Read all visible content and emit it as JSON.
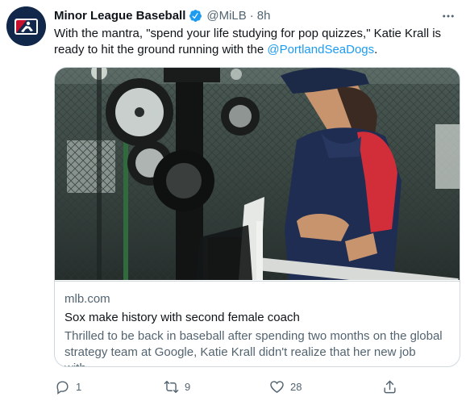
{
  "tweet": {
    "author_name": "Minor League Baseball",
    "handle": "@MiLB",
    "separator": "·",
    "time": "8h",
    "text_before": "With the mantra, \"spend your life studying for pop quizzes,\" Katie Krall is ready to hit the ground running with the ",
    "mention": "@PortlandSeaDogs",
    "text_after": "."
  },
  "card": {
    "domain": "mlb.com",
    "title": "Sox make history with second female coach",
    "description": "Thrilled to be back in baseball after spending two months on the global strategy team at Google, Katie Krall didn't realize that her new job with..."
  },
  "actions": {
    "reply_count": "1",
    "retweet_count": "9",
    "like_count": "28"
  },
  "colors": {
    "accent": "#1d9bf0",
    "secondary_text": "#536471",
    "avatar_bg": "#11284b",
    "logo_red": "#c8102e"
  },
  "icons": {
    "avatar": "milb-logo-icon",
    "verified": "verified-badge-icon",
    "more": "more-dots-icon",
    "reply": "reply-icon",
    "retweet": "retweet-icon",
    "like": "heart-icon",
    "share": "share-icon"
  }
}
